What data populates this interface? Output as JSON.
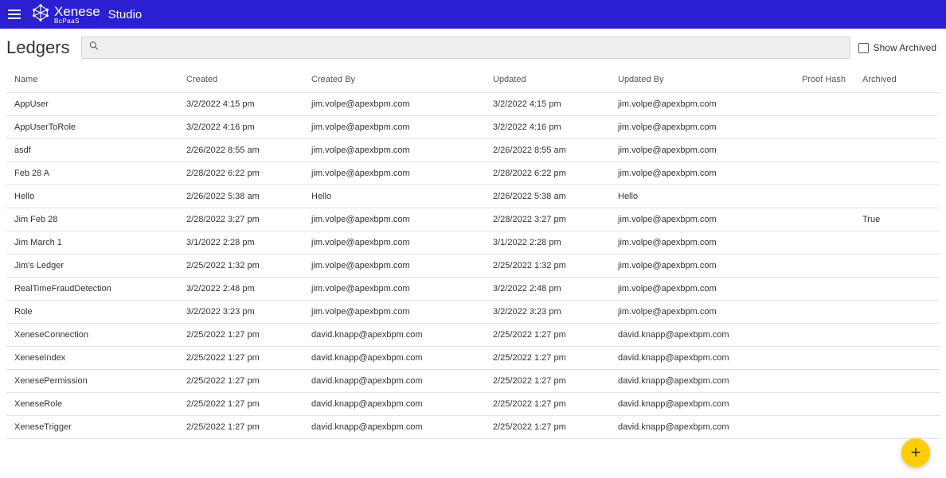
{
  "header": {
    "brand": "Xenese",
    "tagline": "BcPaaS",
    "studio": "Studio"
  },
  "page": {
    "title": "Ledgers",
    "search_placeholder": "",
    "show_archived_label": "Show Archived"
  },
  "columns": {
    "name": "Name",
    "created": "Created",
    "created_by": "Created By",
    "updated": "Updated",
    "updated_by": "Updated By",
    "proof_hash": "Proof Hash",
    "archived": "Archived"
  },
  "rows": [
    {
      "name": "AppUser",
      "created": "3/2/2022 4:15 pm",
      "created_by": "jim.volpe@apexbpm.com",
      "updated": "3/2/2022 4:15 pm",
      "updated_by": "jim.volpe@apexbpm.com",
      "proof": "",
      "archived": ""
    },
    {
      "name": "AppUserToRole",
      "created": "3/2/2022 4:16 pm",
      "created_by": "jim.volpe@apexbpm.com",
      "updated": "3/2/2022 4:16 pm",
      "updated_by": "jim.volpe@apexbpm.com",
      "proof": "",
      "archived": ""
    },
    {
      "name": "asdf",
      "created": "2/26/2022 8:55 am",
      "created_by": "jim.volpe@apexbpm.com",
      "updated": "2/26/2022 8:55 am",
      "updated_by": "jim.volpe@apexbpm.com",
      "proof": "",
      "archived": ""
    },
    {
      "name": "Feb 28 A",
      "created": "2/28/2022 6:22 pm",
      "created_by": "jim.volpe@apexbpm.com",
      "updated": "2/28/2022 6:22 pm",
      "updated_by": "jim.volpe@apexbpm.com",
      "proof": "",
      "archived": ""
    },
    {
      "name": "Hello",
      "created": "2/26/2022 5:38 am",
      "created_by": "Hello",
      "updated": "2/26/2022 5:38 am",
      "updated_by": "Hello",
      "proof": "",
      "archived": ""
    },
    {
      "name": "Jim Feb 28",
      "created": "2/28/2022 3:27 pm",
      "created_by": "jim.volpe@apexbpm.com",
      "updated": "2/28/2022 3:27 pm",
      "updated_by": "jim.volpe@apexbpm.com",
      "proof": "",
      "archived": "True"
    },
    {
      "name": "Jim March 1",
      "created": "3/1/2022 2:28 pm",
      "created_by": "jim.volpe@apexbpm.com",
      "updated": "3/1/2022 2:28 pm",
      "updated_by": "jim.volpe@apexbpm.com",
      "proof": "",
      "archived": ""
    },
    {
      "name": "Jim's Ledger",
      "created": "2/25/2022 1:32 pm",
      "created_by": "jim.volpe@apexbpm.com",
      "updated": "2/25/2022 1:32 pm",
      "updated_by": "jim.volpe@apexbpm.com",
      "proof": "",
      "archived": ""
    },
    {
      "name": "RealTimeFraudDetection",
      "created": "3/2/2022 2:48 pm",
      "created_by": "jim.volpe@apexbpm.com",
      "updated": "3/2/2022 2:48 pm",
      "updated_by": "jim.volpe@apexbpm.com",
      "proof": "",
      "archived": ""
    },
    {
      "name": "Role",
      "created": "3/2/2022 3:23 pm",
      "created_by": "jim.volpe@apexbpm.com",
      "updated": "3/2/2022 3:23 pm",
      "updated_by": "jim.volpe@apexbpm.com",
      "proof": "",
      "archived": ""
    },
    {
      "name": "XeneseConnection",
      "created": "2/25/2022 1:27 pm",
      "created_by": "david.knapp@apexbpm.com",
      "updated": "2/25/2022 1:27 pm",
      "updated_by": "david.knapp@apexbpm.com",
      "proof": "",
      "archived": ""
    },
    {
      "name": "XeneseIndex",
      "created": "2/25/2022 1:27 pm",
      "created_by": "david.knapp@apexbpm.com",
      "updated": "2/25/2022 1:27 pm",
      "updated_by": "david.knapp@apexbpm.com",
      "proof": "",
      "archived": ""
    },
    {
      "name": "XenesePermission",
      "created": "2/25/2022 1:27 pm",
      "created_by": "david.knapp@apexbpm.com",
      "updated": "2/25/2022 1:27 pm",
      "updated_by": "david.knapp@apexbpm.com",
      "proof": "",
      "archived": ""
    },
    {
      "name": "XeneseRole",
      "created": "2/25/2022 1:27 pm",
      "created_by": "david.knapp@apexbpm.com",
      "updated": "2/25/2022 1:27 pm",
      "updated_by": "david.knapp@apexbpm.com",
      "proof": "",
      "archived": ""
    },
    {
      "name": "XeneseTrigger",
      "created": "2/25/2022 1:27 pm",
      "created_by": "david.knapp@apexbpm.com",
      "updated": "2/25/2022 1:27 pm",
      "updated_by": "david.knapp@apexbpm.com",
      "proof": "",
      "archived": ""
    }
  ],
  "fab_label": "+"
}
